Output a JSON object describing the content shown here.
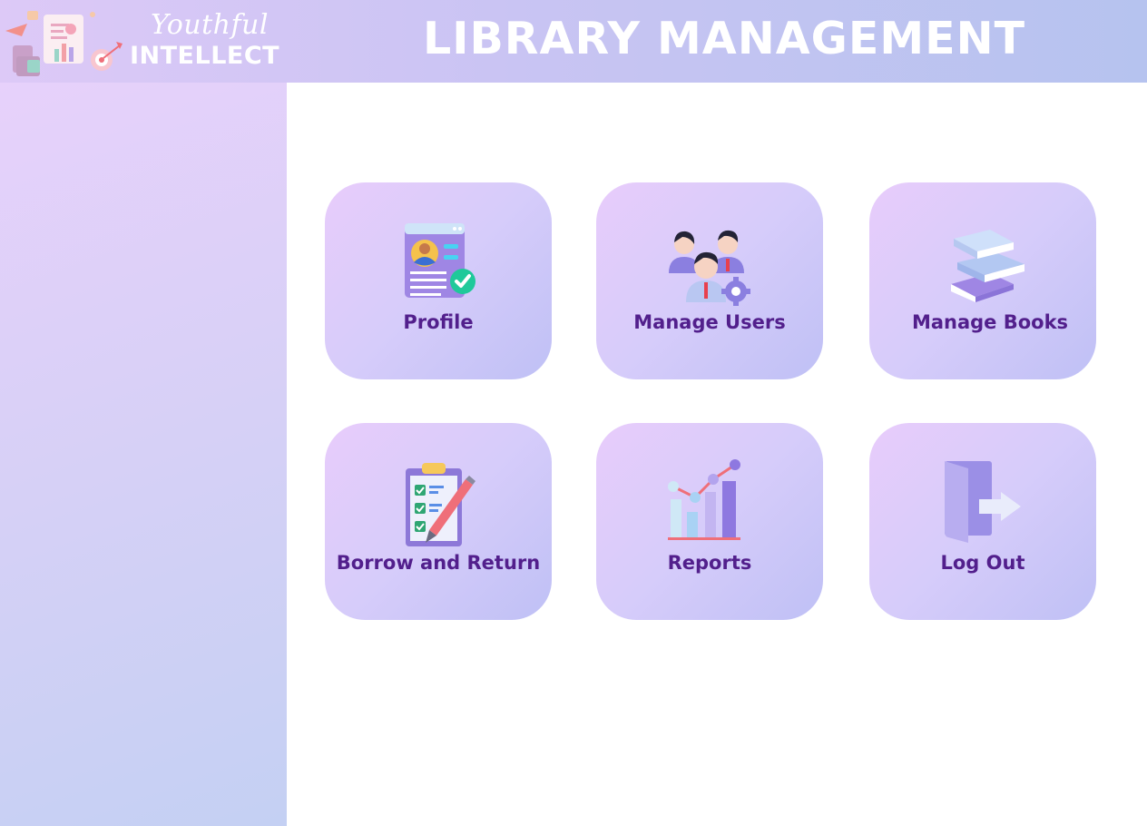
{
  "header": {
    "brand_script": "Youthful",
    "brand_name": "INTELLECT",
    "title": "LIBRARY MANAGEMENT"
  },
  "tiles": [
    {
      "label": "Profile",
      "icon": "profile-card-icon"
    },
    {
      "label": "Manage Users",
      "icon": "users-gear-icon"
    },
    {
      "label": "Manage Books",
      "icon": "books-stack-icon"
    },
    {
      "label": "Borrow and Return",
      "icon": "clipboard-checklist-icon"
    },
    {
      "label": "Reports",
      "icon": "bar-chart-icon"
    },
    {
      "label": "Log Out",
      "icon": "logout-door-icon"
    }
  ],
  "colors": {
    "header_gradient": [
      "#ddc9f7",
      "#b6c3ef"
    ],
    "sidebar_gradient": [
      "#e7d1fb",
      "#c4d0f3"
    ],
    "tile_gradient": [
      "#e8ccfb",
      "#bfc0f5"
    ],
    "tile_label": "#521f8c"
  }
}
